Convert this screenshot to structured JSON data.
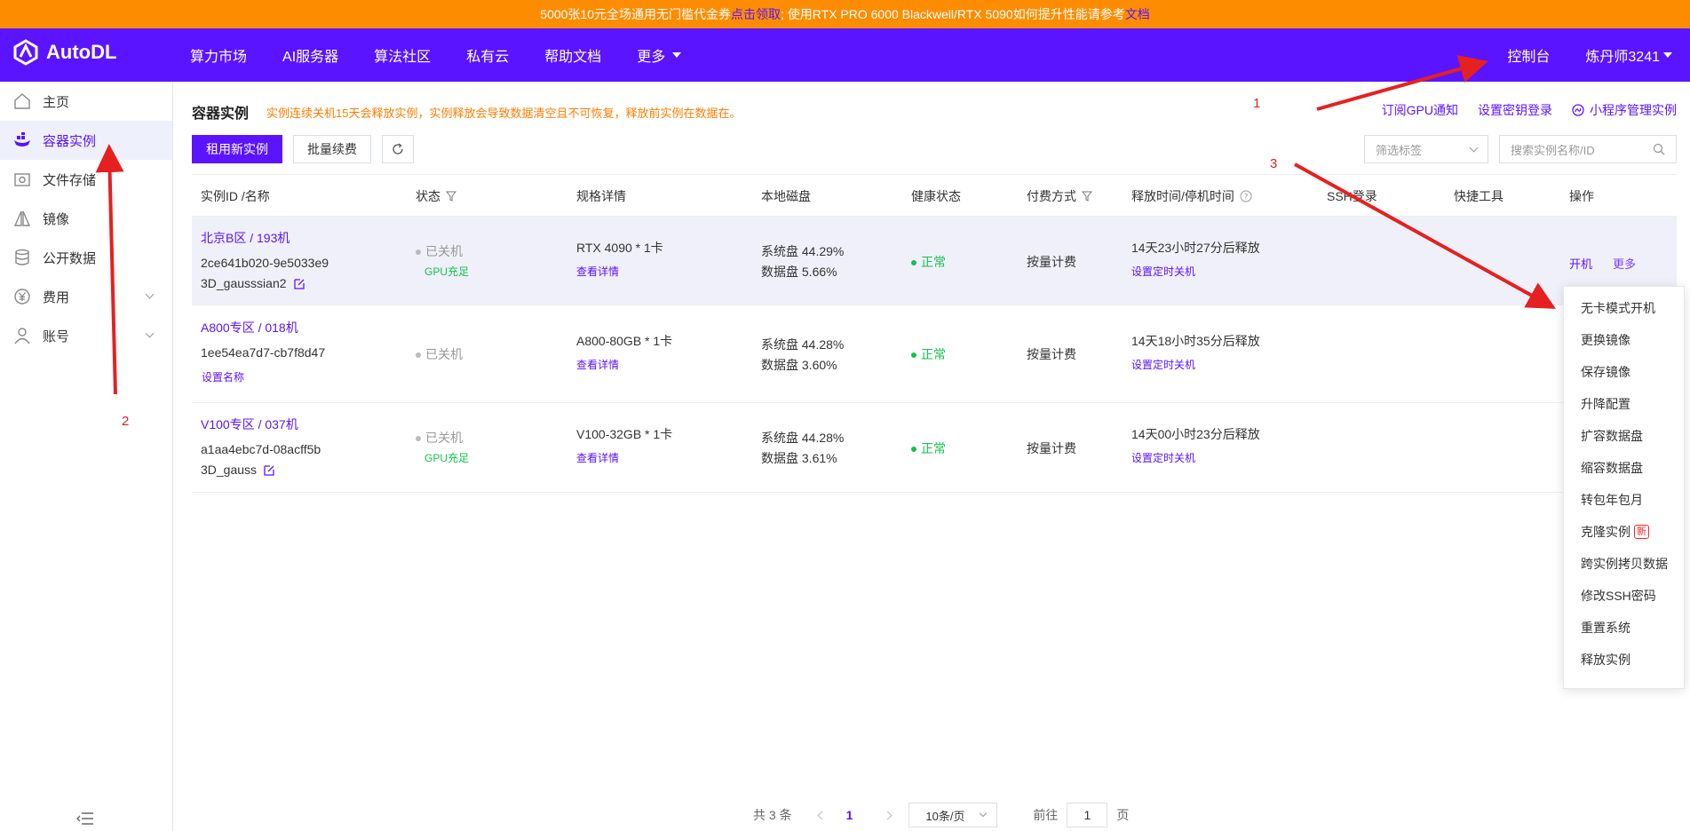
{
  "banner": {
    "text_a": "5000张10元全场通用无门槛代金券",
    "link_a": "点击领取",
    "text_b": "; 使用RTX PRO 6000 Blackwell/RTX 5090如何提升性能请参考",
    "link_b": "文档"
  },
  "brand": {
    "name": "AutoDL"
  },
  "nav": {
    "items": [
      "算力市场",
      "AI服务器",
      "算法社区",
      "私有云",
      "帮助文档",
      "更多"
    ],
    "console": "控制台",
    "user": "炼丹师3241"
  },
  "sidebar": {
    "items": [
      {
        "label": "主页",
        "icon": "home-icon"
      },
      {
        "label": "容器实例",
        "icon": "container-icon"
      },
      {
        "label": "文件存储",
        "icon": "storage-icon"
      },
      {
        "label": "镜像",
        "icon": "image-icon"
      },
      {
        "label": "公开数据",
        "icon": "database-icon"
      },
      {
        "label": "费用",
        "icon": "yuan-icon"
      },
      {
        "label": "账号",
        "icon": "user-icon"
      }
    ]
  },
  "page": {
    "title": "容器实例",
    "notice": "实例连续关机15天会释放实例，实例释放会导致数据清空且不可恢复，释放前实例在数据在。",
    "links": [
      "订阅GPU通知",
      "设置密钥登录",
      "小程序管理实例"
    ]
  },
  "toolbar": {
    "rent_label": "租用新实例",
    "renew_label": "批量续费",
    "filter_placeholder": "筛选标签",
    "search_placeholder": "搜索实例名称/ID"
  },
  "table": {
    "headers": [
      "实例ID /名称",
      "状态",
      "规格详情",
      "本地磁盘",
      "健康状态",
      "付费方式",
      "释放时间/停机时间",
      "SSH登录",
      "快捷工具",
      "操作"
    ],
    "rows": [
      {
        "region": "北京B区 / 193机",
        "id": "2ce641b020-9e5033e9",
        "name": "3D_gausssian2",
        "status": "已关机",
        "gpu": "GPU充足",
        "spec": "RTX 4090 * 1卡",
        "spec_link": "查看详情",
        "disk_sys": "系统盘 44.29%",
        "disk_data": "数据盘 5.66%",
        "health": "正常",
        "pay": "按量计费",
        "release": "14天23小时27分后释放",
        "release_link": "设置定时关机",
        "op_start": "开机",
        "op_more": "更多"
      },
      {
        "region": "A800专区 / 018机",
        "id": "1ee54ea7d7-cb7f8d47",
        "name_link": "设置名称",
        "status": "已关机",
        "spec": "A800-80GB * 1卡",
        "spec_link": "查看详情",
        "disk_sys": "系统盘 44.28%",
        "disk_data": "数据盘 3.60%",
        "health": "正常",
        "pay": "按量计费",
        "release": "14天18小时35分后释放",
        "release_link": "设置定时关机"
      },
      {
        "region": "V100专区 / 037机",
        "id": "a1aa4ebc7d-08acff5b",
        "name": "3D_gauss",
        "status": "已关机",
        "gpu": "GPU充足",
        "spec": "V100-32GB * 1卡",
        "spec_link": "查看详情",
        "disk_sys": "系统盘 44.28%",
        "disk_data": "数据盘 3.61%",
        "health": "正常",
        "pay": "按量计费",
        "release": "14天00小时23分后释放",
        "release_link": "设置定时关机"
      }
    ]
  },
  "dropdown": {
    "items": [
      "无卡模式开机",
      "更换镜像",
      "保存镜像",
      "升降配置",
      "扩容数据盘",
      "缩容数据盘",
      "转包年包月",
      "克隆实例",
      "跨实例拷贝数据",
      "修改SSH密码",
      "重置系统",
      "释放实例"
    ],
    "new_badge": "新"
  },
  "pagination": {
    "total": "共 3 条",
    "current": "1",
    "page_size": "10条/页",
    "goto_label": "前往",
    "goto_value": "1",
    "page_suffix": "页"
  },
  "annotations": {
    "one": "1",
    "two": "2",
    "three": "3"
  },
  "colors": {
    "brand": "#5a14ff",
    "banner": "#fe8c00",
    "annotation": "#e62020",
    "ok": "#13c24b"
  }
}
